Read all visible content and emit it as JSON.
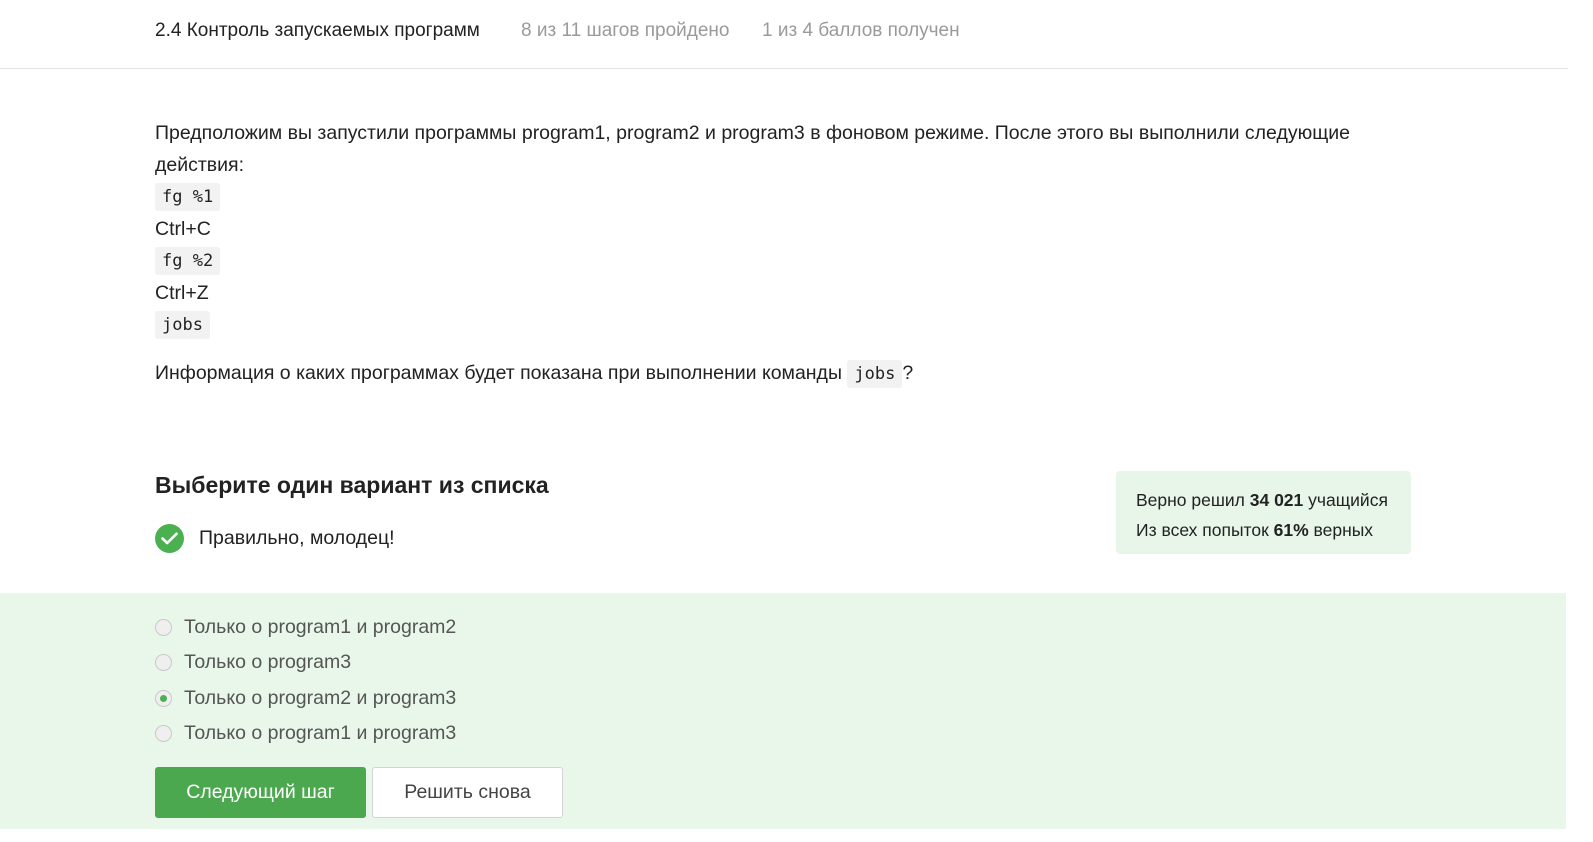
{
  "header": {
    "lesson_title": "2.4 Контроль запускаемых программ",
    "steps_progress": "8 из 11 шагов пройдено",
    "score": "1 из 4 баллов  получен"
  },
  "task": {
    "intro": "Предположим вы запустили программы program1, program2 и program3 в фоновом режиме. После этого вы выполнили следующие действия:",
    "commands": [
      {
        "type": "code",
        "text": "fg %1"
      },
      {
        "type": "text",
        "text": "Ctrl+C"
      },
      {
        "type": "code",
        "text": "fg %2"
      },
      {
        "type": "text",
        "text": "Ctrl+Z"
      },
      {
        "type": "code",
        "text": "jobs"
      }
    ],
    "question_prefix": "Информация о каких программах будет показана при выполнении команды",
    "question_code": "jobs",
    "question_suffix": "?"
  },
  "quiz": {
    "title": "Выберите один вариант из списка",
    "feedback": "Правильно, молодец!",
    "stats": {
      "solved_prefix": "Верно решил ",
      "solved_count": "34 021",
      "solved_suffix": " учащийся",
      "attempts_prefix": "Из всех попыток ",
      "attempts_percent": "61%",
      "attempts_suffix": " верных"
    },
    "options": [
      {
        "label": "Только о program1 и program2",
        "checked": false
      },
      {
        "label": "Только о program3",
        "checked": false
      },
      {
        "label": "Только о program2 и program3",
        "checked": true
      },
      {
        "label": "Только о program1 и program3",
        "checked": false
      }
    ],
    "next_button": "Следующий шаг",
    "retry_button": "Решить снова"
  },
  "colors": {
    "accent": "#4ba84f",
    "panel_bg": "#e8f7e9",
    "stats_bg": "#e8f5e9"
  },
  "icons": {
    "feedback": "check-circle-icon",
    "option_radio": "radio-icon"
  }
}
